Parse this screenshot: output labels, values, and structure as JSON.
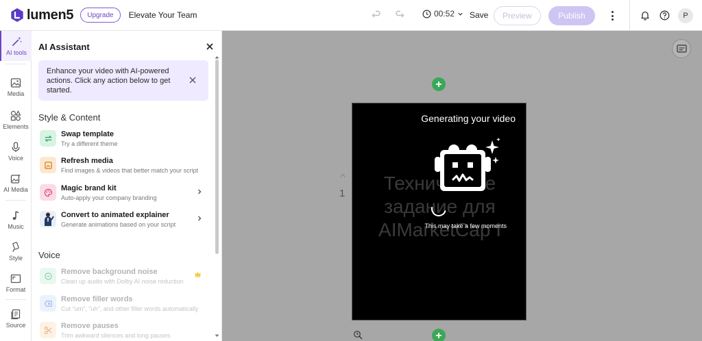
{
  "app": {
    "logo_text": "lumen5",
    "upgrade_label": "Upgrade",
    "team_name": "Elevate Your Team"
  },
  "toolbar": {
    "duration": "00:52",
    "save_label": "Save",
    "preview_label": "Preview",
    "publish_label": "Publish",
    "avatar_initial": "P"
  },
  "rail": {
    "items": [
      {
        "label": "AI tools",
        "icon": "magic-wand-icon"
      },
      {
        "label": "Media",
        "icon": "image-icon"
      },
      {
        "label": "Elements",
        "icon": "shapes-icon"
      },
      {
        "label": "Voice",
        "icon": "microphone-icon"
      },
      {
        "label": "AI Media",
        "icon": "ai-image-icon"
      },
      {
        "label": "Music",
        "icon": "music-note-icon"
      },
      {
        "label": "Style",
        "icon": "brush-icon"
      },
      {
        "label": "Format",
        "icon": "aspect-ratio-icon"
      },
      {
        "label": "Source",
        "icon": "document-stack-icon"
      }
    ]
  },
  "panel": {
    "title": "AI Assistant",
    "intro": "Enhance your video with AI-powered actions. Click any action below to get started.",
    "sections": [
      {
        "heading": "Style & Content",
        "actions": [
          {
            "title": "Swap template",
            "subtitle": "Try a different theme"
          },
          {
            "title": "Refresh media",
            "subtitle": "Find images & videos that better match your script"
          },
          {
            "title": "Magic brand kit",
            "subtitle": "Auto-apply your company branding"
          },
          {
            "title": "Convert to animated explainer",
            "subtitle": "Generate animations based on your script"
          }
        ]
      },
      {
        "heading": "Voice",
        "actions": [
          {
            "title": "Remove background noise",
            "subtitle": "Clean up audio with Dolby AI noise reduction"
          },
          {
            "title": "Remove filler words",
            "subtitle": "Cut \"um\", \"uh\", and other filler words automatically"
          },
          {
            "title": "Remove pauses",
            "subtitle": "Trim awkward silences and long pauses"
          }
        ]
      }
    ]
  },
  "canvas": {
    "scene_number": "1",
    "scene_text": "Техническое задание для AIMarketCap I",
    "overlay_title": "Generating your video",
    "overlay_subtitle": "This may take a few moments"
  },
  "colors": {
    "brand": "#6b46c1",
    "add_green": "#3aa856",
    "canvas_bg": "#a7a7a7"
  }
}
